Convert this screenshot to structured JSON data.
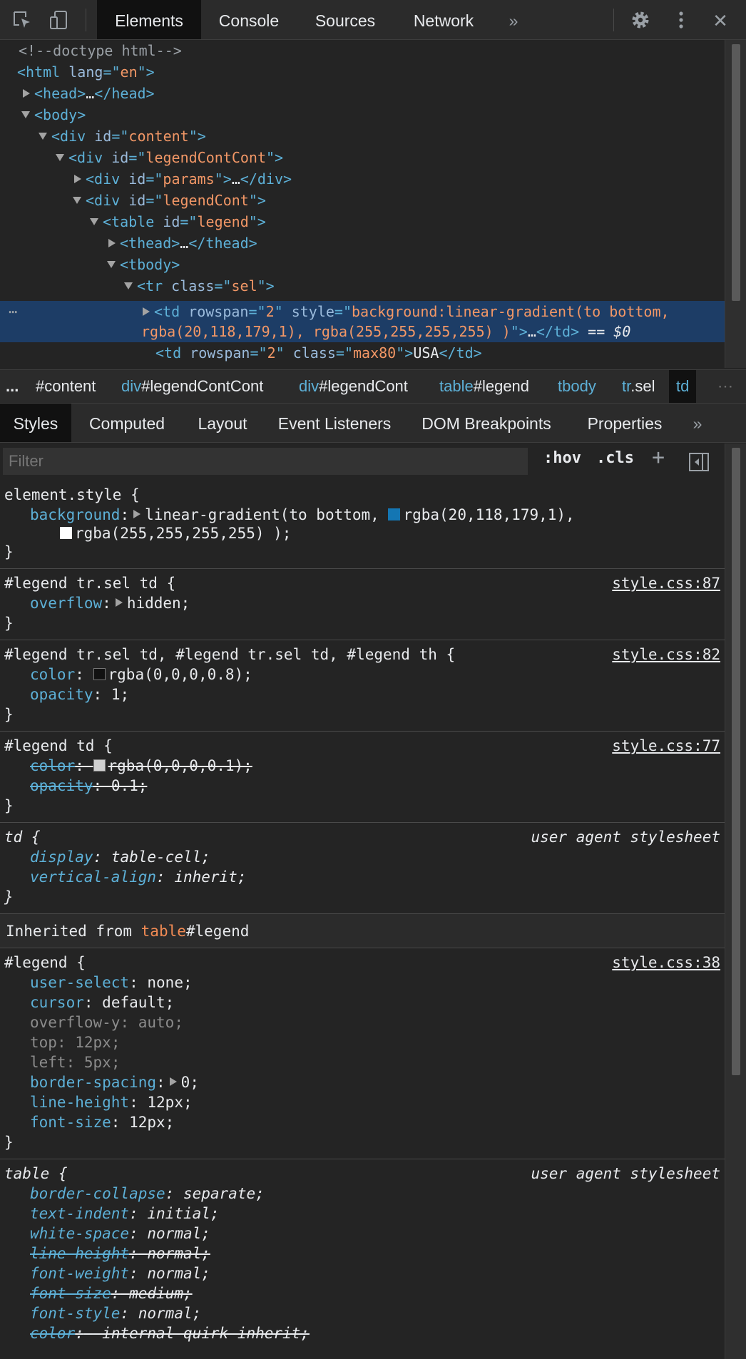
{
  "toolbar": {
    "tabs": [
      {
        "label": "Elements",
        "active": true
      },
      {
        "label": "Console",
        "active": false
      },
      {
        "label": "Sources",
        "active": false
      },
      {
        "label": "Network",
        "active": false
      }
    ],
    "more_label": "»",
    "close_label": "✕"
  },
  "dom": {
    "lines": [
      {
        "html": "<span class=\"c-comment\">&lt;!--doctype html--&gt;</span>"
      },
      {
        "html": "<span class=\"c-tag\">&lt;html</span> <span class=\"c-attr\">lang</span><span class=\"c-tag\">=\"</span><span class=\"c-val\">en</span><span class=\"c-tag\">\"&gt;</span>"
      },
      {
        "html": "<span class=\"c-tag\">&lt;head&gt;</span><span class=\"c-text\">…</span><span class=\"c-tag\">&lt;/head&gt;</span>"
      },
      {
        "html": "<span class=\"c-tag\">&lt;body&gt;</span>"
      },
      {
        "html": "<span class=\"c-tag\">&lt;div</span> <span class=\"c-attr\">id</span><span class=\"c-tag\">=\"</span><span class=\"c-val\">content</span><span class=\"c-tag\">\"&gt;</span>"
      },
      {
        "html": "<span class=\"c-tag\">&lt;div</span> <span class=\"c-attr\">id</span><span class=\"c-tag\">=\"</span><span class=\"c-val\">legendContCont</span><span class=\"c-tag\">\"&gt;</span>"
      },
      {
        "html": "<span class=\"c-tag\">&lt;div</span> <span class=\"c-attr\">id</span><span class=\"c-tag\">=\"</span><span class=\"c-val\">params</span><span class=\"c-tag\">\"&gt;</span><span class=\"c-text\">…</span><span class=\"c-tag\">&lt;/div&gt;</span>"
      },
      {
        "html": "<span class=\"c-tag\">&lt;div</span> <span class=\"c-attr\">id</span><span class=\"c-tag\">=\"</span><span class=\"c-val\">legendCont</span><span class=\"c-tag\">\"&gt;</span>"
      },
      {
        "html": "<span class=\"c-tag\">&lt;table</span> <span class=\"c-attr\">id</span><span class=\"c-tag\">=\"</span><span class=\"c-val\">legend</span><span class=\"c-tag\">\"&gt;</span>"
      },
      {
        "html": "<span class=\"c-tag\">&lt;thead&gt;</span><span class=\"c-text\">…</span><span class=\"c-tag\">&lt;/thead&gt;</span>"
      },
      {
        "html": "<span class=\"c-tag\">&lt;tbody&gt;</span>"
      },
      {
        "html": "<span class=\"c-tag\">&lt;tr</span> <span class=\"c-attr\">class</span><span class=\"c-tag\">=\"</span><span class=\"c-val\">sel</span><span class=\"c-tag\">\"&gt;</span>"
      },
      {
        "html": "<span class=\"c-tag\">&lt;td</span> <span class=\"c-attr\">rowspan</span><span class=\"c-tag\">=\"</span><span class=\"c-val\">2</span><span class=\"c-tag\">\"</span> <span class=\"c-attr\">style</span><span class=\"c-tag\">=\"</span><span class=\"c-val\">background:linear-gradient(to bottom,</span>"
      },
      {
        "html": "<span class=\"c-val\">rgba(20,118,179,1), rgba(255,255,255,255) )</span><span class=\"c-tag\">\"&gt;</span><span class=\"c-text\">…</span><span class=\"c-tag\">&lt;/td&gt;</span><span class=\"c-text\"> == </span><span class=\"c-dollar\">$0</span>"
      },
      {
        "html": "<span class=\"c-tag\">&lt;td</span> <span class=\"c-attr\">rowspan</span><span class=\"c-tag\">=\"</span><span class=\"c-val\">2</span><span class=\"c-tag\">\"</span> <span class=\"c-attr\">class</span><span class=\"c-tag\">=\"</span><span class=\"c-val\">max80</span><span class=\"c-tag\">\"&gt;</span><span class=\"c-text\">USA</span><span class=\"c-tag\">&lt;/td&gt;</span>"
      }
    ],
    "ellipsis": "…"
  },
  "breadcrumbs": [
    {
      "tag": "",
      "id": "#content"
    },
    {
      "tag": "div",
      "id": "#legendContCont"
    },
    {
      "tag": "div",
      "id": "#legendCont"
    },
    {
      "tag": "table",
      "id": "#legend"
    },
    {
      "tag": "tbody",
      "id": ""
    },
    {
      "tag": "tr",
      "id": ".sel"
    },
    {
      "tag": "td",
      "id": ""
    }
  ],
  "breadcrumb_more": "...",
  "subtabs": [
    {
      "label": "Styles",
      "active": true
    },
    {
      "label": "Computed",
      "active": false
    },
    {
      "label": "Layout",
      "active": false
    },
    {
      "label": "Event Listeners",
      "active": false
    },
    {
      "label": "DOM Breakpoints",
      "active": false
    },
    {
      "label": "Properties",
      "active": false
    }
  ],
  "subtab_more": "»",
  "filter": {
    "placeholder": "Filter",
    "hov": ":hov",
    "cls": ".cls",
    "plus": "+"
  },
  "colors": {
    "swatch_blue": "#1476b3",
    "swatch_white": "#ffffff",
    "swatch_black_08": "#111111",
    "swatch_black_01": "#d0d0d0"
  },
  "styles": {
    "element_style": {
      "selector": "element.style {",
      "prop": "background",
      "val_a": "linear-gradient(to bottom, ",
      "val_b": "rgba(20,118,179,1),",
      "val_c": "rgba(255,255,255,255) );",
      "close": "}"
    },
    "rule1": {
      "selector": "#legend tr.sel td {",
      "source": "style.css:87",
      "prop": "overflow",
      "val": "hidden;",
      "close": "}"
    },
    "rule2": {
      "selector": "#legend tr.sel td, #legend tr.sel td, #legend th {",
      "source": "style.css:82",
      "p1": "color",
      "v1": "rgba(0,0,0,0.8);",
      "p2": "opacity",
      "v2": "1;",
      "close": "}"
    },
    "rule3": {
      "selector": "#legend td {",
      "source": "style.css:77",
      "p1": "color",
      "v1": "rgba(0,0,0,0.1);",
      "p2": "opacity",
      "v2": "0.1;",
      "close": "}"
    },
    "rule4": {
      "selector": "td {",
      "source": "user agent stylesheet",
      "p1": "display",
      "v1": "table-cell;",
      "p2": "vertical-align",
      "v2": "inherit;",
      "close": "}"
    },
    "inherited": {
      "prefix": "Inherited from ",
      "tag": "table",
      "id": "#legend"
    },
    "rule5": {
      "selector": "#legend {",
      "source": "style.css:38",
      "props": [
        {
          "p": "user-select",
          "v": "none;",
          "inactive": false
        },
        {
          "p": "cursor",
          "v": "default;",
          "inactive": false
        },
        {
          "p": "overflow-y",
          "v": "auto;",
          "inactive": true
        },
        {
          "p": "top",
          "v": "12px;",
          "inactive": true
        },
        {
          "p": "left",
          "v": "5px;",
          "inactive": true
        },
        {
          "p": "border-spacing",
          "v": "0;",
          "inactive": false
        },
        {
          "p": "line-height",
          "v": "12px;",
          "inactive": false
        },
        {
          "p": "font-size",
          "v": "12px;",
          "inactive": false
        }
      ],
      "close": "}"
    },
    "rule6": {
      "selector": "table {",
      "source": "user agent stylesheet",
      "props": [
        {
          "p": "border-collapse",
          "v": "separate;",
          "strike": false
        },
        {
          "p": "text-indent",
          "v": "initial;",
          "strike": false
        },
        {
          "p": "white-space",
          "v": "normal;",
          "strike": false
        },
        {
          "p": "line-height",
          "v": "normal;",
          "strike": true
        },
        {
          "p": "font-weight",
          "v": "normal;",
          "strike": false
        },
        {
          "p": "font-size",
          "v": "medium;",
          "strike": true
        },
        {
          "p": "font-style",
          "v": "normal;",
          "strike": false
        },
        {
          "p": "color",
          "v": "-internal-quirk-inherit;",
          "strike": true
        }
      ]
    }
  }
}
